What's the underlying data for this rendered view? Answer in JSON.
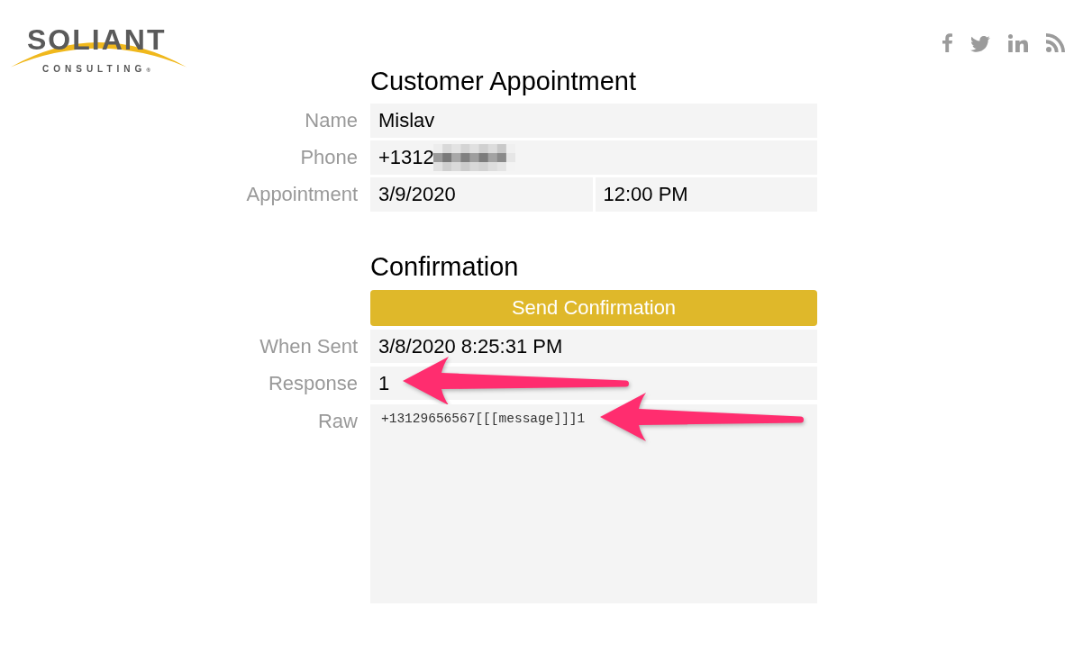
{
  "logo": {
    "wordmark": "SOLIANT",
    "tagline": "CONSULTING$_{®}$"
  },
  "social_links": [
    {
      "kind": "facebook"
    },
    {
      "kind": "twitter"
    },
    {
      "kind": "linkedin"
    },
    {
      "kind": "rss"
    }
  ],
  "appointment": {
    "heading": "Customer Appointment",
    "rows": [
      {
        "label": "Name",
        "values": [
          "Mislav"
        ],
        "redacted": false
      },
      {
        "label": "Phone",
        "values": [
          "+1312"
        ],
        "redacted": true
      },
      {
        "label": "Appointment",
        "values": [
          "3/9/2020",
          "12:00 PM"
        ],
        "redacted": false
      }
    ]
  },
  "confirmation": {
    "heading": "Confirmation",
    "button": "Send Confirmation",
    "rows": [
      {
        "kind": "field",
        "label": "When Sent",
        "values": [
          "3/8/2020 8:25:31 PM"
        ],
        "arrow": false
      },
      {
        "kind": "field",
        "label": "Response",
        "values": [
          "1"
        ],
        "arrow": true
      },
      {
        "kind": "textarea",
        "label": "Raw",
        "values": [
          "+13129656567[[[message]]]1"
        ],
        "arrow": true
      }
    ]
  }
}
